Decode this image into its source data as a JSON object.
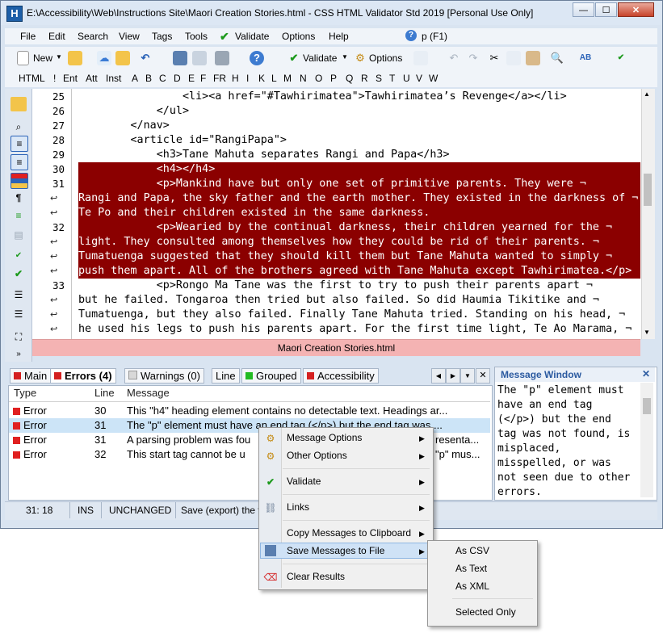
{
  "window": {
    "title": "E:\\Accessibility\\Web\\Instructions Site\\Maori Creation Stories.html - CSS HTML Validator Std 2019 [Personal Use Only]",
    "app_icon_letter": "H"
  },
  "menubar": {
    "items": [
      "File",
      "Edit",
      "Search",
      "View",
      "Tags",
      "Tools",
      "Validate",
      "Options",
      "Help"
    ],
    "help_field": "p (F1)"
  },
  "toolbar": {
    "new_label": "New",
    "validate_label": "Validate",
    "options_label": "Options"
  },
  "tagbar": {
    "items": [
      "HTML",
      "!",
      "Ent",
      "Att",
      "Inst",
      "A",
      "B",
      "C",
      "D",
      "E",
      "F",
      "FR",
      "H",
      "I",
      "K",
      "L",
      "M",
      "N",
      "O",
      "P",
      "Q",
      "R",
      "S",
      "T",
      "U",
      "V",
      "W"
    ]
  },
  "editor": {
    "lines": [
      {
        "num": "25",
        "text": "                <li><a href=\"#Tawhirimatea\">Tawhirimatea’s Revenge</a></li>",
        "selected": false
      },
      {
        "num": "26",
        "text": "            </ul>",
        "selected": false
      },
      {
        "num": "27",
        "text": "        </nav>",
        "selected": false
      },
      {
        "num": "28",
        "text": "        <article id=\"RangiPapa\">",
        "selected": false
      },
      {
        "num": "29",
        "text": "            <h3>Tane Mahuta separates Rangi and Papa</h3>",
        "selected": false
      },
      {
        "num": "30",
        "text": "            <h4></h4>",
        "selected": true
      },
      {
        "num": "31",
        "text": "            <p>Mankind have but only one set of primitive parents. They were ¬",
        "selected": true
      },
      {
        "num": "",
        "text": "Rangi and Papa, the sky father and the earth mother. They existed in the darkness of ¬",
        "selected": true
      },
      {
        "num": "",
        "text": "Te Po and their children existed in the same darkness.",
        "selected": true
      },
      {
        "num": "32",
        "text": "            <p>Wearied by the continual darkness, their children yearned for the ¬",
        "selected": true
      },
      {
        "num": "",
        "text": "light. They consulted among themselves how they could be rid of their parents. ¬",
        "selected": true
      },
      {
        "num": "",
        "text": "Tumatuenga suggested that they should kill them but Tane Mahuta wanted to simply ¬",
        "selected": true
      },
      {
        "num": "",
        "text": "push them apart. All of the brothers agreed with Tane Mahuta except Tawhirimatea.</p>",
        "selected": true
      },
      {
        "num": "33",
        "text": "            <p>Rongo Ma Tane was the first to try to push their parents apart ¬",
        "selected": false
      },
      {
        "num": "",
        "text": "but he failed. Tongaroa then tried but also failed. So did Haumia Tikitike and ¬",
        "selected": false
      },
      {
        "num": "",
        "text": "Tumatuenga, but they also failed. Finally Tane Mahuta tried. Standing on his head, ¬",
        "selected": false
      },
      {
        "num": "",
        "text": "he used his legs to push his parents apart. For the first time light, Te Ao Marama, ¬",
        "selected": false
      }
    ],
    "file_tab": "Maori Creation Stories.html"
  },
  "bottom_tabs": [
    {
      "label": "Main",
      "color": "#d42020",
      "active": false
    },
    {
      "label": "Errors (4)",
      "color": "#d42020",
      "active": true
    },
    {
      "label": "Warnings (0)",
      "color": "#d8d8d8",
      "active": false
    },
    {
      "label": "Line",
      "color": "",
      "active": false
    },
    {
      "label": "Grouped",
      "color": "#22bb22",
      "active": false
    },
    {
      "label": "Accessibility",
      "color": "#d42020",
      "active": false
    }
  ],
  "messages": {
    "headers": {
      "type": "Type",
      "line": "Line",
      "message": "Message"
    },
    "rows": [
      {
        "type": "Error",
        "line": "30",
        "message": "This \"h4\" heading element contains no detectable text. Headings ar..."
      },
      {
        "type": "Error",
        "line": "31",
        "message": "The \"p\" element must have an end tag (</p>) but the end tag was ..."
      },
      {
        "type": "Error",
        "line": "31",
        "message": "A parsing problem was fou",
        "message_tail": "resenta..."
      },
      {
        "type": "Error",
        "line": "32",
        "message": "This start tag cannot be u",
        "message_tail": "\"p\" mus..."
      }
    ],
    "error_color": "#e02020"
  },
  "message_window": {
    "title": "Message Window",
    "text": "The \"p\" element must have an end tag (</p>) but the end tag was not found, is misplaced, misspelled, or was not seen due to other errors."
  },
  "statusbar": {
    "position": "31: 18",
    "mode": "INS",
    "state": "UNCHANGED",
    "hint": "Save (export) the v"
  },
  "context_menu": {
    "items": [
      "Message Options",
      "Other Options",
      "Validate",
      "Links",
      "Copy Messages to Clipboard",
      "Save Messages to File",
      "Clear Results"
    ]
  },
  "submenu": {
    "items": [
      "As CSV",
      "As Text",
      "As XML",
      "Selected Only"
    ]
  }
}
